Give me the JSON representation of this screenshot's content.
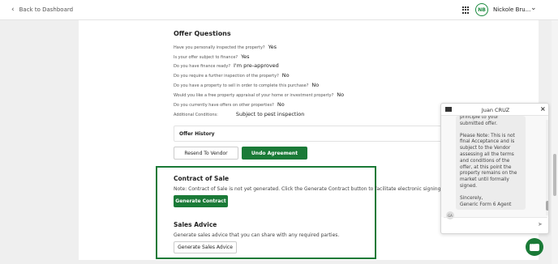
{
  "header": {
    "back_label": "Back to Dashboard",
    "avatar_initials": "NB",
    "user_name": "Nickole Bru...",
    "grid_icon": "apps-grid-icon"
  },
  "offer_questions": {
    "title": "Offer Questions",
    "items": [
      {
        "q": "Have you personally inspected the property?",
        "a": "Yes"
      },
      {
        "q": "Is your offer subject to finance?",
        "a": "Yes"
      },
      {
        "q": "Do you have finance ready?",
        "a": "I'm pre-approved"
      },
      {
        "q": "Do you require a further inspection of the property?",
        "a": "No"
      },
      {
        "q": "Do you have a property to sell in order to complete this purchase?",
        "a": "No"
      },
      {
        "q": "Would you like a free property appraisal of your home or investment property?",
        "a": "No"
      },
      {
        "q": "Do you currently have offers on other properties?",
        "a": "No"
      },
      {
        "q": "Additional Conditions:",
        "a": "Subject to pest inspection"
      }
    ]
  },
  "offer_history": {
    "label": "Offer History"
  },
  "actions": {
    "resend_label": "Resend To Vendor",
    "undo_label": "Undo Agreement"
  },
  "contract": {
    "title": "Contract of Sale",
    "note": "Note: Contract of Sale is not yet generated. Click the Generate Contract button to facilitate electronic signing of con",
    "button_label": "Generate Contract"
  },
  "sales_advice": {
    "title": "Sales Advice",
    "note": "Generate sales advice that you can share with any required parties.",
    "button_label": "Generate Sales Advice"
  },
  "chat": {
    "contact_name": "Juan CRUZ",
    "close_label": "×",
    "message_top": "principle to your submitted offer.",
    "message_note": "Please Note: This is not final Acceptance and is subject to the Vendor assessing all the terms and conditions of the offer, at this point the property remains on the market until formally signed.",
    "message_signoff": "Sincerely,",
    "message_sender": "Generic Form 6 Agent",
    "sender_initials": "GA"
  },
  "colors": {
    "brand_green": "#1a7a37",
    "highlight_border": "#1a7a37"
  }
}
